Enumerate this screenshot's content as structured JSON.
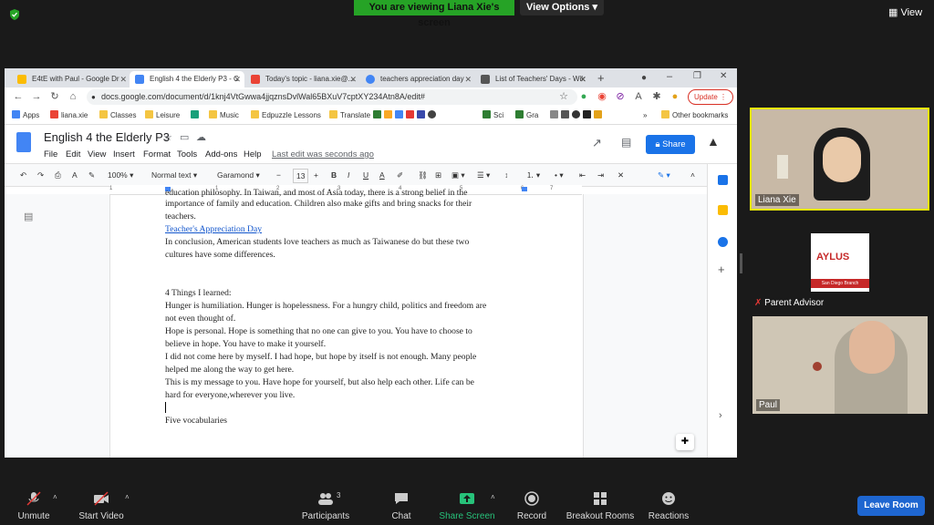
{
  "zoom": {
    "banner": "You are viewing Liana Xie's screen",
    "view_options": "View Options",
    "view_label": "View"
  },
  "browser": {
    "tabs": [
      {
        "label": "E4tE with Paul - Google Dr"
      },
      {
        "label": "English 4 the Elderly P3 - C"
      },
      {
        "label": "Today's topic - liana.xie@..."
      },
      {
        "label": "teachers appreciation day"
      },
      {
        "label": "List of Teachers' Days - Wik"
      }
    ],
    "url": "docs.google.com/document/d/1knj4VtGwwa4jjqznsDvlWal65BXuV7cptXY234Atn8A/edit#",
    "update_label": "Update",
    "bookmarks": [
      "Apps",
      "liana.xie",
      "Classes",
      "Leisure",
      "Music",
      "Edpuzzle Lessons",
      "Translate",
      "Sci",
      "Gra"
    ],
    "other_bookmarks": "Other bookmarks"
  },
  "docs": {
    "title": "English 4 the Elderly P3",
    "menus": [
      "File",
      "Edit",
      "View",
      "Insert",
      "Format",
      "Tools",
      "Add-ons",
      "Help"
    ],
    "last_edit": "Last edit was seconds ago",
    "share_label": "Share",
    "toolbar": {
      "zoom": "100%",
      "style": "Normal text",
      "font": "Garamond",
      "size": "13"
    },
    "ruler_marks": [
      "1",
      "1",
      "2",
      "3",
      "4",
      "5",
      "6",
      "7"
    ],
    "lines": [
      "education philosophy. In Taiwan, and most of Asia today, there is a strong belief in the",
      "importance of family and education. Children also make gifts and bring snacks for their",
      "teachers.",
      "Teacher's Appreciation Day",
      "In conclusion, American students love teachers as much as Taiwanese do but these two",
      "cultures have some differences.",
      "",
      "",
      "4 Things I learned:",
      "Hunger is humiliation. Hunger is hopelessness. For a hungry child, politics and freedom are",
      "not even thought of.",
      "Hope is personal. Hope is something that no one can give to you. You have to choose to",
      "believe in hope. You have to make it yourself.",
      "I did not come here by myself. I had hope, but hope by itself is not enough. Many people",
      "helped me along the way to get here.",
      "This is my message to you. Have hope for yourself, but also help each other. Life can be",
      "hard for everyone,wherever you live.",
      "",
      "Five vocabularies"
    ]
  },
  "participants": {
    "count": "3",
    "people": [
      {
        "name": "Liana Xie"
      },
      {
        "name": "Parent Advisor"
      },
      {
        "name": "Paul"
      }
    ],
    "advisor_logo_text": "AYLUS",
    "advisor_logo_sub": "San Diego Branch"
  },
  "controls": {
    "unmute": "Unmute",
    "start_video": "Start Video",
    "participants": "Participants",
    "chat": "Chat",
    "share_screen": "Share Screen",
    "record": "Record",
    "breakout": "Breakout Rooms",
    "reactions": "Reactions",
    "leave": "Leave Room"
  },
  "colors": {
    "zoom_green": "#26a326",
    "docs_blue": "#1a73e8",
    "leave_blue": "#1e66d0",
    "active_speaker": "#e6e600"
  }
}
